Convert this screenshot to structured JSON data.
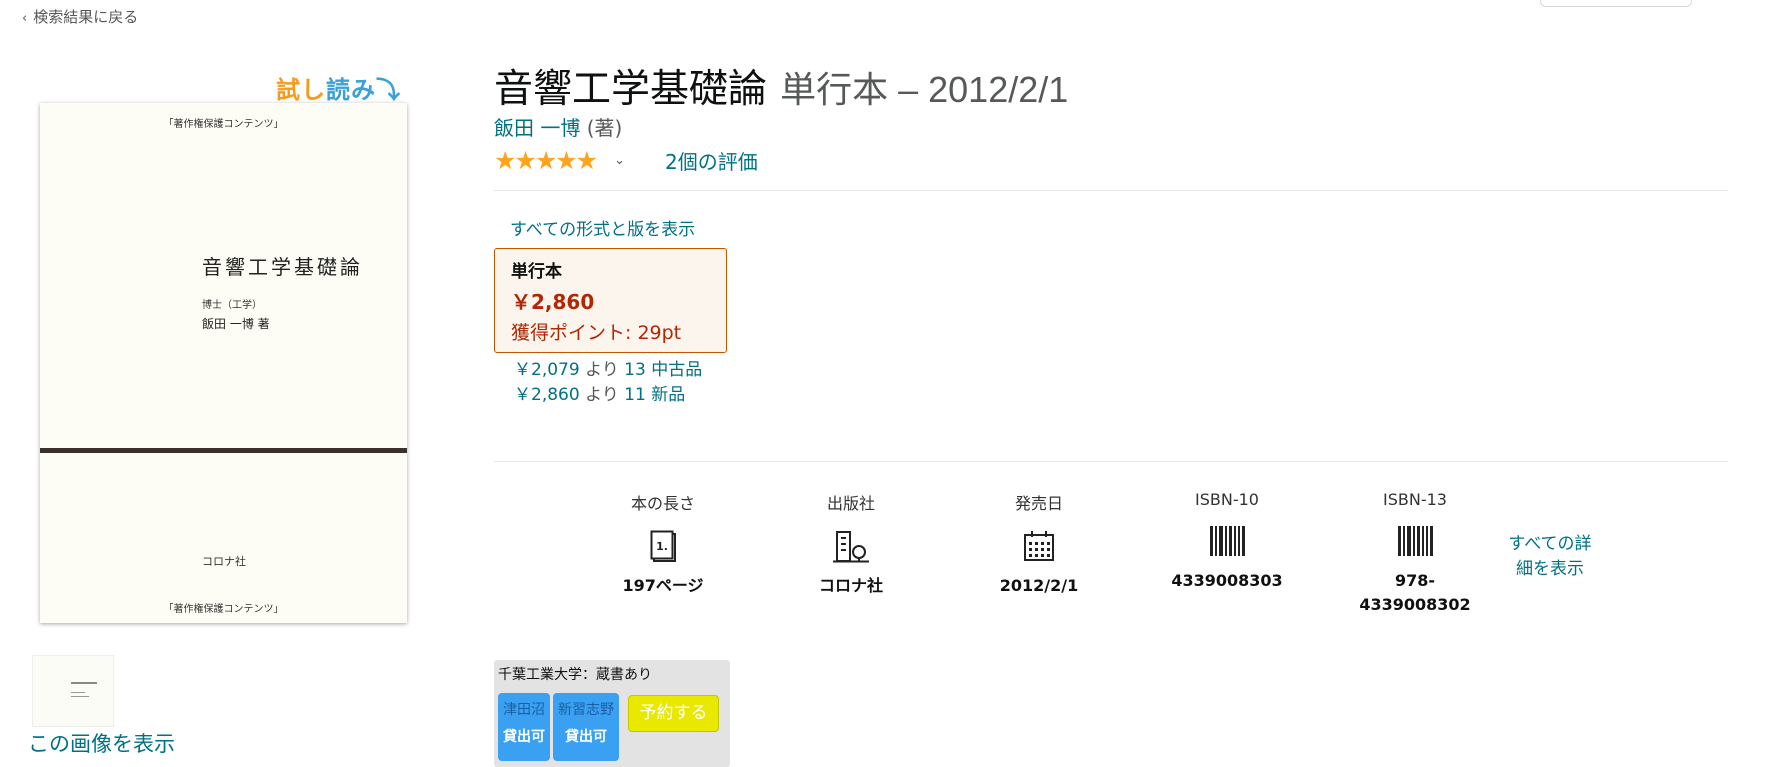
{
  "nav": {
    "back_label": "検索結果に戻る"
  },
  "sample": {
    "part1": "試し",
    "part2": "読み",
    "arrow": "⤵"
  },
  "cover": {
    "top_text": "「著作権保護コンテンツ」",
    "title": "音響工学基礎論",
    "degree": "博士（工学）",
    "author": "飯田 一博 著",
    "publisher": "コロナ社",
    "bottom_text": "「著作権保護コンテンツ」"
  },
  "gallery": {
    "view_image_label": "この画像を表示"
  },
  "product": {
    "title": "音響工学基礎論",
    "binding_date": "単行本 – 2012/2/1",
    "author_name": "飯田 一博",
    "author_role": "(著)",
    "stars": "★★★★★",
    "rating_chevron": "⌄",
    "rating_count_label": "2個の評価"
  },
  "formats": {
    "all_formats_label": "すべての形式と版を表示",
    "selected": {
      "name": "単行本",
      "price": "￥2,860",
      "points": "獲得ポイント: 29pt"
    },
    "offers": [
      {
        "price": "￥2,079",
        "from": "より",
        "offer": "13 中古品"
      },
      {
        "price": "￥2,860",
        "from": "より",
        "offer": "11 新品"
      }
    ]
  },
  "details": {
    "items": [
      {
        "label": "本の長さ",
        "icon": "page-count-icon",
        "value": "197ページ"
      },
      {
        "label": "出版社",
        "icon": "publisher-building-icon",
        "value": "コロナ社"
      },
      {
        "label": "発売日",
        "icon": "calendar-icon",
        "value": "2012/2/1"
      },
      {
        "label": "ISBN-10",
        "icon": "barcode-icon",
        "value": "4339008303"
      },
      {
        "label": "ISBN-13",
        "icon": "barcode-icon",
        "value_line1": "978-",
        "value_line2": "4339008302"
      }
    ],
    "see_all_line1": "すべての詳",
    "see_all_line2": "細を表示"
  },
  "library": {
    "name": "千葉工業大学：蔵書あり",
    "branches": [
      {
        "name": "津田沼",
        "status": "貸出可"
      },
      {
        "name": "新習志野",
        "status": "貸出可"
      }
    ],
    "reserve_label": "予約する"
  },
  "colors": {
    "link": "#007185",
    "price": "#b12704",
    "star": "#ffa41c",
    "format_border": "#c45500",
    "branch_bg": "#3aa0f2",
    "reserve_bg": "#e9e900"
  }
}
